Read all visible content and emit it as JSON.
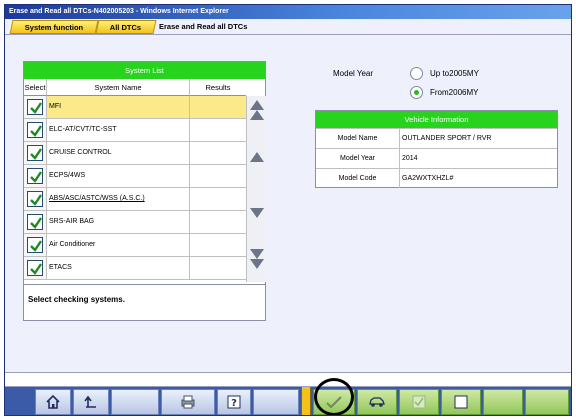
{
  "window": {
    "title": "Erase and Read all DTCs-N402005203 - Windows Internet Explorer"
  },
  "breadcrumb": {
    "system_function": "System function",
    "all_dtcs": "All DTCs",
    "current": "Erase and Read all DTCs"
  },
  "system_list": {
    "header": "System List",
    "columns": {
      "select": "Select",
      "name": "System Name",
      "results": "Results"
    },
    "rows": [
      {
        "name": "MFI",
        "checked": true,
        "selected": true
      },
      {
        "name": "ELC-AT/CVT/TC-SST",
        "checked": true
      },
      {
        "name": "CRUISE CONTROL",
        "checked": true
      },
      {
        "name": "ECPS/4WS",
        "checked": true
      },
      {
        "name": "ABS/ASC/ASTC/WSS (A.S.C.)",
        "checked": true
      },
      {
        "name": "SRS-AIR BAG",
        "checked": true
      },
      {
        "name": "Air Conditioner",
        "checked": true
      },
      {
        "name": "ETACS",
        "checked": true
      }
    ],
    "message": "Select checking systems."
  },
  "model_year": {
    "label": "Model Year",
    "options": [
      {
        "label": "Up to2005MY",
        "checked": false
      },
      {
        "label": "From2006MY",
        "checked": true
      }
    ]
  },
  "vehicle_info": {
    "header": "Vehicle Information",
    "rows": [
      {
        "label": "Model Name",
        "value": "OUTLANDER SPORT / RVR"
      },
      {
        "label": "Model Year",
        "value": "2014"
      },
      {
        "label": "Model Code",
        "value": "GA2WXTXHZL#"
      }
    ]
  },
  "toolbar": {
    "buttons": [
      "home-icon",
      "back-icon",
      "print-icon",
      "help-icon",
      "check-icon",
      "vehicle-icon",
      "checkbox-checked-icon",
      "checkbox-empty-icon"
    ]
  },
  "colors": {
    "green_header": "#28d31e",
    "selected_row": "#fbe98a",
    "toolbar": "#3b5ba8",
    "tab_yellow": "#f3c21a"
  }
}
